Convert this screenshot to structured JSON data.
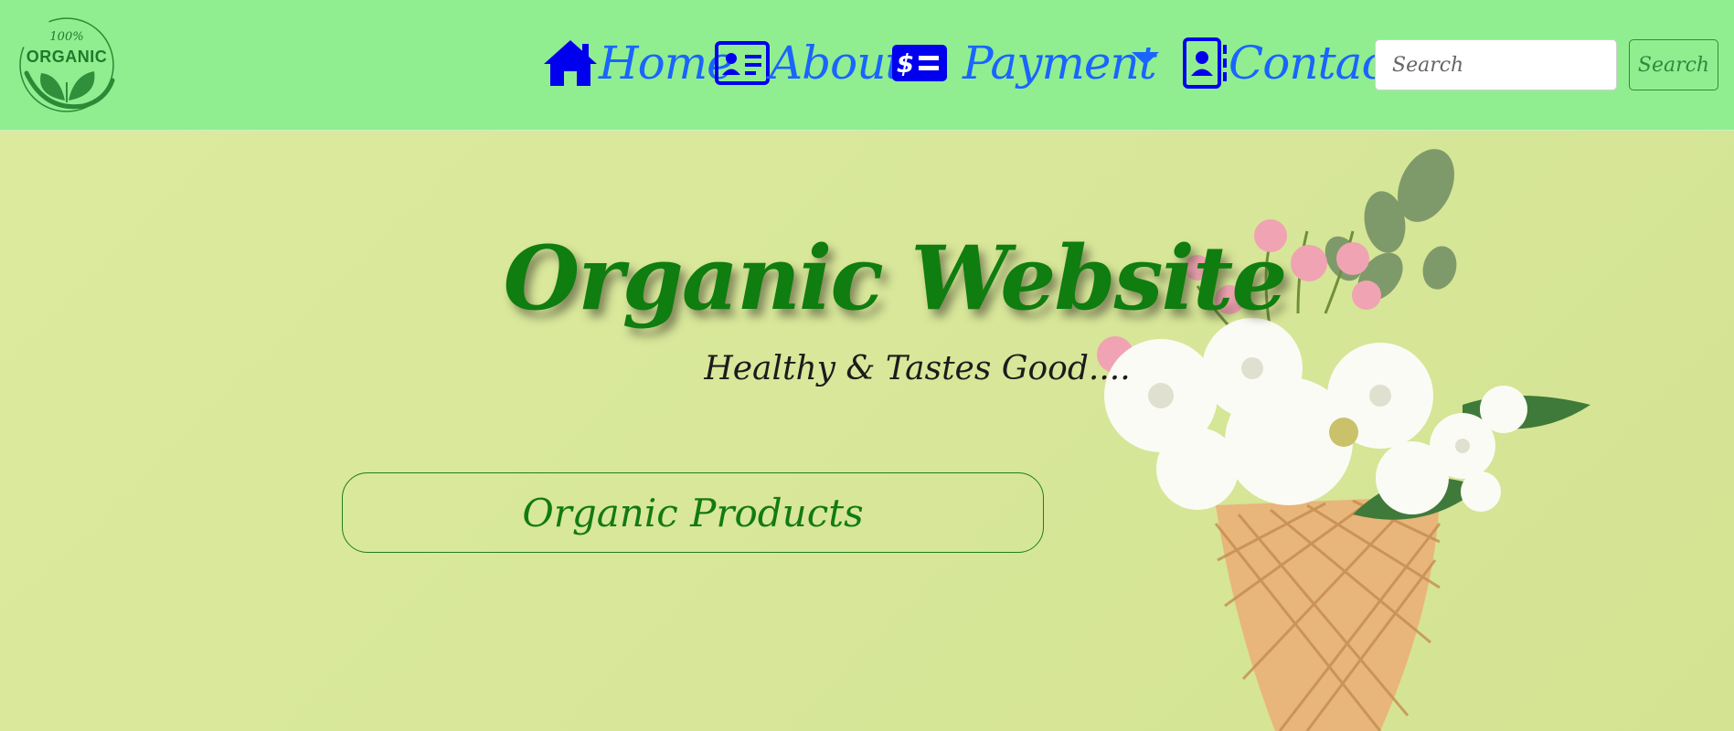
{
  "logo": {
    "line1": "100%",
    "line2": "ORGANIC"
  },
  "nav": {
    "items": [
      {
        "label": "Home",
        "icon": "home-icon"
      },
      {
        "label": "About",
        "icon": "id-card-icon"
      },
      {
        "label": "Payment",
        "icon": "money-check-icon"
      },
      {
        "label": "Contact",
        "icon": "contact-book-icon"
      }
    ],
    "search_placeholder": "Search",
    "search_button": "Search"
  },
  "hero": {
    "title": "Organic Website",
    "subtitle": "Healthy & Tastes Good....",
    "products_button": "Organic Products"
  },
  "colors": {
    "navbar_bg": "#90ee90",
    "nav_link": "#1a64ff",
    "icon_blue": "#0000ee",
    "hero_bg": "#dcea9e",
    "title_green": "#0f7d0f"
  }
}
